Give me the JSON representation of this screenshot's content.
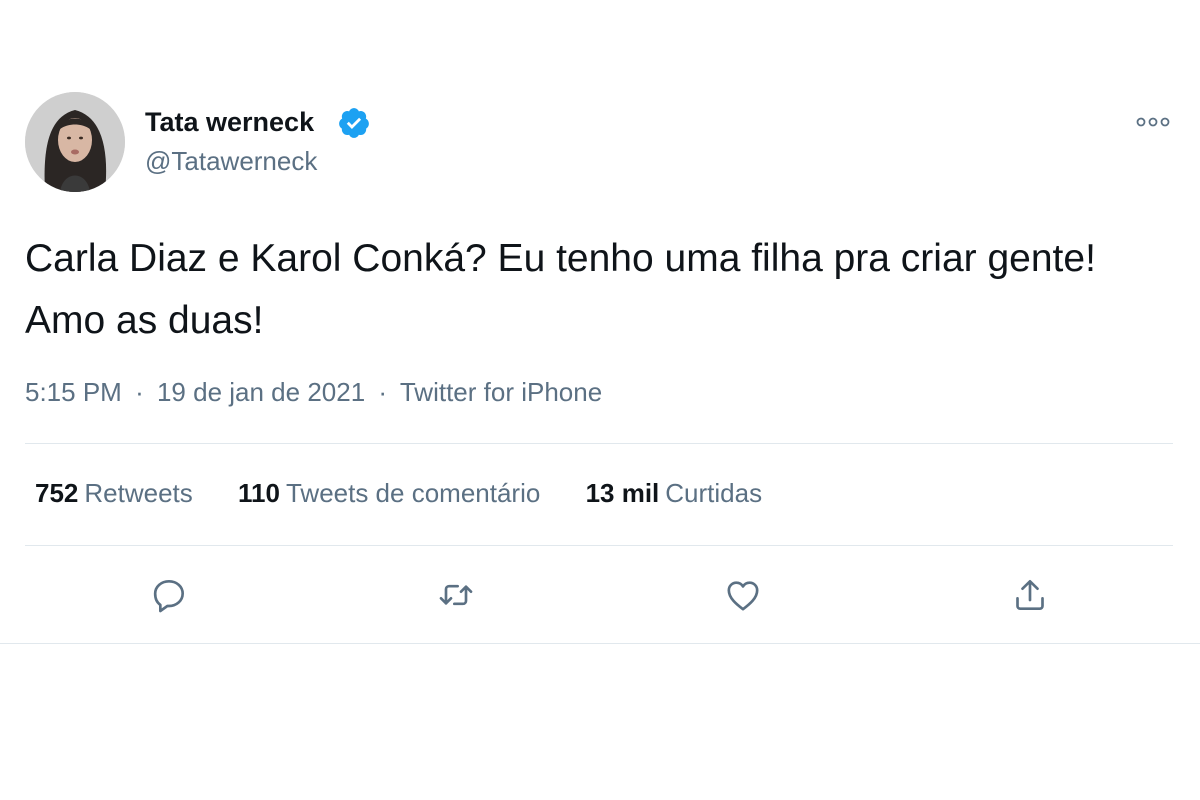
{
  "author": {
    "name": "Tata werneck",
    "handle": "@Tatawerneck"
  },
  "tweet": {
    "text": "Carla Diaz e Karol Conká? Eu tenho uma filha pra criar gente! Amo as duas!",
    "time": "5:15 PM",
    "date": "19 de jan de 2021",
    "source": "Twitter for iPhone",
    "separator": "·"
  },
  "stats": {
    "retweets_count": "752",
    "retweets_label": "Retweets",
    "quotes_count": "110",
    "quotes_label": "Tweets de comentário",
    "likes_count": "13 mil",
    "likes_label": "Curtidas"
  },
  "icons": {
    "verified": "verified-badge-icon",
    "more": "more-options-icon",
    "reply": "reply-icon",
    "retweet": "retweet-icon",
    "like": "heart-icon",
    "share": "share-icon"
  },
  "colors": {
    "verified": "#1da1f2",
    "text": "#0f1419",
    "secondary": "#5b7083",
    "divider": "#e1e8ed"
  }
}
